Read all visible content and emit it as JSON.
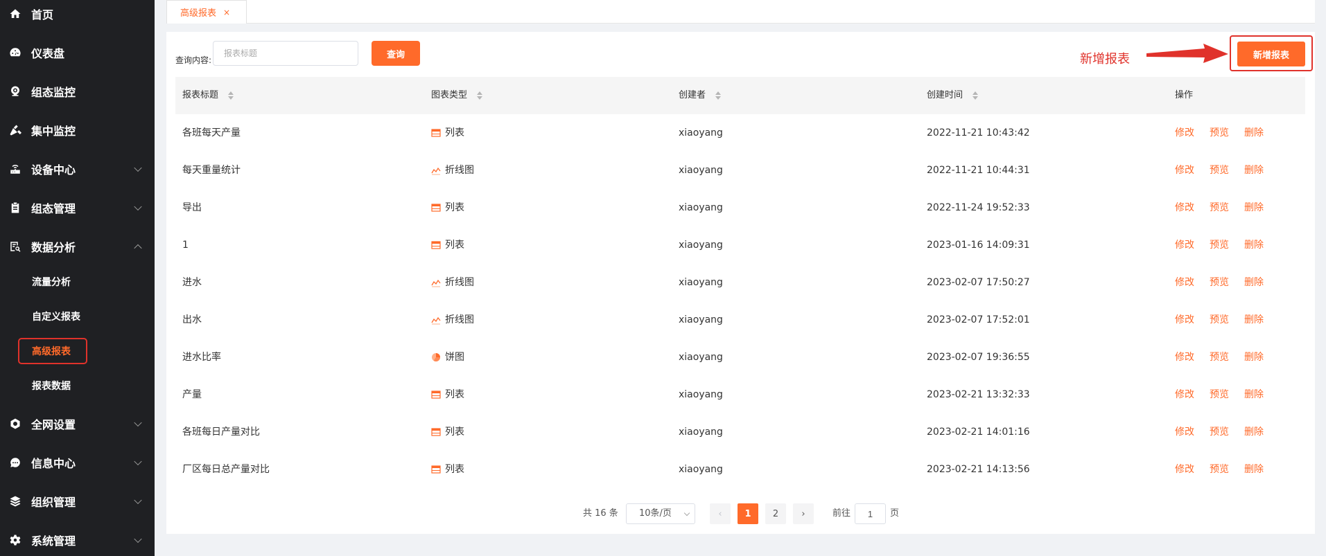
{
  "sidebar": {
    "items": [
      {
        "label": "首页",
        "icon": "home-icon"
      },
      {
        "label": "仪表盘",
        "icon": "dashboard-icon"
      },
      {
        "label": "组态监控",
        "icon": "webcam-icon"
      },
      {
        "label": "集中监控",
        "icon": "hammer-icon"
      },
      {
        "label": "设备中心",
        "icon": "router-icon"
      },
      {
        "label": "组态管理",
        "icon": "clipboard-icon"
      },
      {
        "label": "数据分析",
        "icon": "data-analysis-icon"
      },
      {
        "label": "全网设置",
        "icon": "gear-icon"
      },
      {
        "label": "信息中心",
        "icon": "chat-icon"
      },
      {
        "label": "组织管理",
        "icon": "layers-icon"
      },
      {
        "label": "系统管理",
        "icon": "settings-icon"
      }
    ],
    "sub_items": [
      {
        "label": "流量分析"
      },
      {
        "label": "自定义报表"
      },
      {
        "label": "高级报表"
      },
      {
        "label": "报表数据"
      }
    ]
  },
  "tabbar": {
    "tabs": [
      {
        "label": "高级报表",
        "close": "×"
      }
    ]
  },
  "search": {
    "label": "查询内容:",
    "placeholder": "报表标题",
    "query_button": "查询"
  },
  "annotation": {
    "text": "新增报表"
  },
  "toolbar": {
    "add_button": "新增报表"
  },
  "table": {
    "headers": [
      "报表标题",
      "图表类型",
      "创建者",
      "创建时间",
      "操作"
    ],
    "rows": [
      {
        "title": "各班每天产量",
        "type": "列表",
        "type_icon": "table-icon",
        "creator": "xiaoyang",
        "time": "2022-11-21 10:43:42"
      },
      {
        "title": "每天重量统计",
        "type": "折线图",
        "type_icon": "line-chart-icon",
        "creator": "xiaoyang",
        "time": "2022-11-21 10:44:31"
      },
      {
        "title": "导出",
        "type": "列表",
        "type_icon": "table-icon",
        "creator": "xiaoyang",
        "time": "2022-11-24 19:52:33"
      },
      {
        "title": "1",
        "type": "列表",
        "type_icon": "table-icon",
        "creator": "xiaoyang",
        "time": "2023-01-16 14:09:31"
      },
      {
        "title": "进水",
        "type": "折线图",
        "type_icon": "line-chart-icon",
        "creator": "xiaoyang",
        "time": "2023-02-07 17:50:27"
      },
      {
        "title": "出水",
        "type": "折线图",
        "type_icon": "line-chart-icon",
        "creator": "xiaoyang",
        "time": "2023-02-07 17:52:01"
      },
      {
        "title": "进水比率",
        "type": "饼图",
        "type_icon": "pie-chart-icon",
        "creator": "xiaoyang",
        "time": "2023-02-07 19:36:55"
      },
      {
        "title": "产量",
        "type": "列表",
        "type_icon": "table-icon",
        "creator": "xiaoyang",
        "time": "2023-02-21 13:32:33"
      },
      {
        "title": "各班每日产量对比",
        "type": "列表",
        "type_icon": "table-icon",
        "creator": "xiaoyang",
        "time": "2023-02-21 14:01:16"
      },
      {
        "title": "厂区每日总产量对比",
        "type": "列表",
        "type_icon": "table-icon",
        "creator": "xiaoyang",
        "time": "2023-02-21 14:13:56"
      }
    ],
    "actions": [
      "修改",
      "预览",
      "删除"
    ]
  },
  "pagination": {
    "total": "共 16 条",
    "page_size": "10条/页",
    "prev": "‹",
    "next": "›",
    "pages": [
      "1",
      "2"
    ],
    "current_page": 1,
    "goto_label": "前往",
    "goto_value": "1",
    "page_suffix": "页"
  },
  "colors": {
    "accent": "#ff6a2a",
    "annotation": "#e0322b",
    "sidebar_bg": "#1f2023"
  }
}
